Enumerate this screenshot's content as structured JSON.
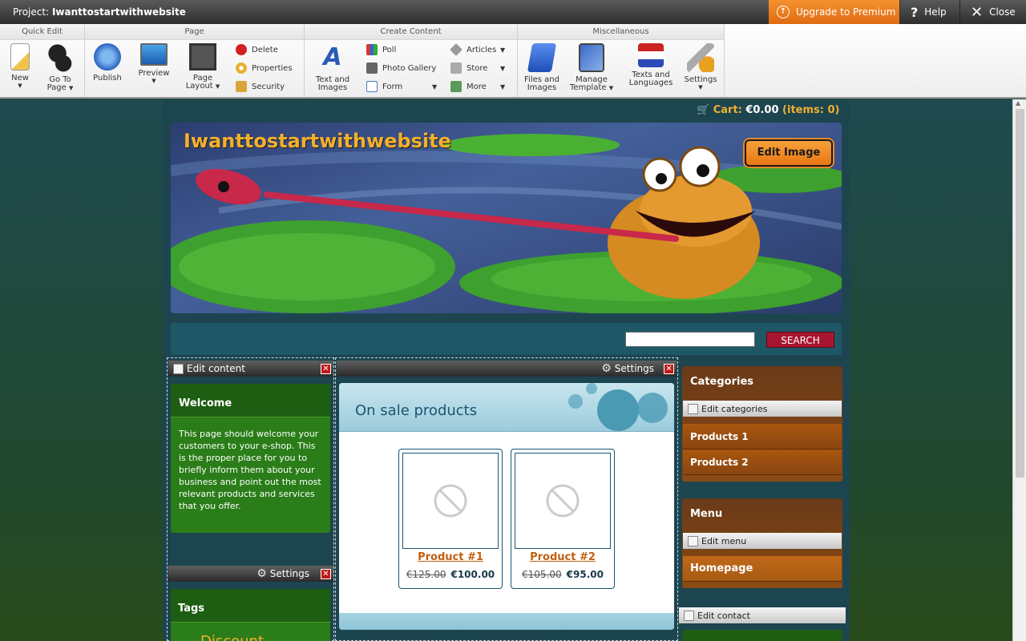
{
  "topbar": {
    "project_label": "Project:",
    "project_name": "Iwanttostartwithwebsite",
    "upgrade": "Upgrade to Premium",
    "help": "Help",
    "close": "Close"
  },
  "ribbon": {
    "groups": {
      "quick_edit": "Quick Edit",
      "page": "Page",
      "create_content": "Create Content",
      "misc": "Miscellaneous"
    },
    "new": "New",
    "goto_1": "Go To",
    "goto_2": "Page",
    "publish": "Publish",
    "preview": "Preview",
    "layout_1": "Page",
    "layout_2": "Layout",
    "delete": "Delete",
    "properties": "Properties",
    "security": "Security",
    "text_1": "Text and",
    "text_2": "Images",
    "poll": "Poll",
    "photo_gallery": "Photo Gallery",
    "form": "Form",
    "articles": "Articles",
    "store": "Store",
    "more": "More",
    "files_1": "Files and",
    "files_2": "Images",
    "template_1": "Manage",
    "template_2": "Template",
    "texts_1": "Texts and",
    "texts_2": "Languages",
    "settings": "Settings"
  },
  "site": {
    "cart_label": "Cart:",
    "cart_value": "€0.00",
    "cart_items": "(items: 0)",
    "title": "Iwanttostartwithwebsite",
    "edit_image": "Edit Image",
    "search_btn": "SEARCH"
  },
  "left": {
    "edit_content": "Edit content",
    "welcome_title": "Welcome",
    "welcome_text": "This page should welcome your customers to your e-shop. This is the proper place for you to briefly inform them about your business and point out the most relevant products and services that you offer.",
    "settings": "Settings",
    "tags_title": "Tags",
    "tags_item": "Discount"
  },
  "center": {
    "settings": "Settings",
    "title": "On sale products",
    "products": [
      {
        "name": "Product #1",
        "old": "€125.00",
        "price": "€100.00"
      },
      {
        "name": "Product #2",
        "old": "€105.00",
        "price": "€95.00"
      }
    ]
  },
  "right": {
    "categories_title": "Categories",
    "edit_categories": "Edit categories",
    "cat_items": [
      "Products 1",
      "Products 2"
    ],
    "menu_title": "Menu",
    "edit_menu": "Edit menu",
    "menu_items": [
      "Homepage"
    ],
    "edit_contact": "Edit contact"
  },
  "colors": {
    "accent_orange": "#e87712",
    "title_gold": "#f5b02a",
    "search_red": "#a81530",
    "welcome_green": "#2a7d18",
    "sidebar_brown": "#8a4510"
  }
}
